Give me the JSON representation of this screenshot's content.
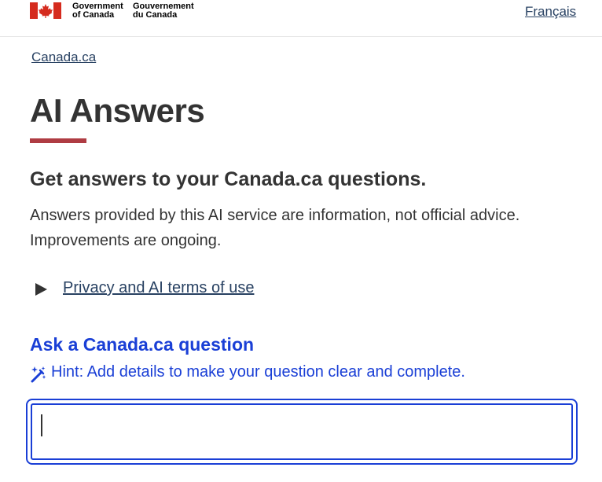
{
  "header": {
    "gov_en_line1": "Government",
    "gov_en_line2": "of Canada",
    "gov_fr_line1": "Gouvernement",
    "gov_fr_line2": "du Canada",
    "language_toggle": "Français"
  },
  "breadcrumb": {
    "home": "Canada.ca"
  },
  "main": {
    "title": "AI Answers",
    "subtitle": "Get answers to your Canada.ca questions.",
    "intro_line1": "Answers provided by this AI service are information, not official advice.",
    "intro_line2": "Improvements are ongoing.",
    "details_summary": "Privacy and AI terms of use"
  },
  "question_form": {
    "label": "Ask a Canada.ca question",
    "hint": "Hint: Add details to make your question clear and complete.",
    "value": ""
  },
  "colors": {
    "accent_red": "#af3c43",
    "link": "#284162",
    "form_blue": "#1a3fd6"
  }
}
